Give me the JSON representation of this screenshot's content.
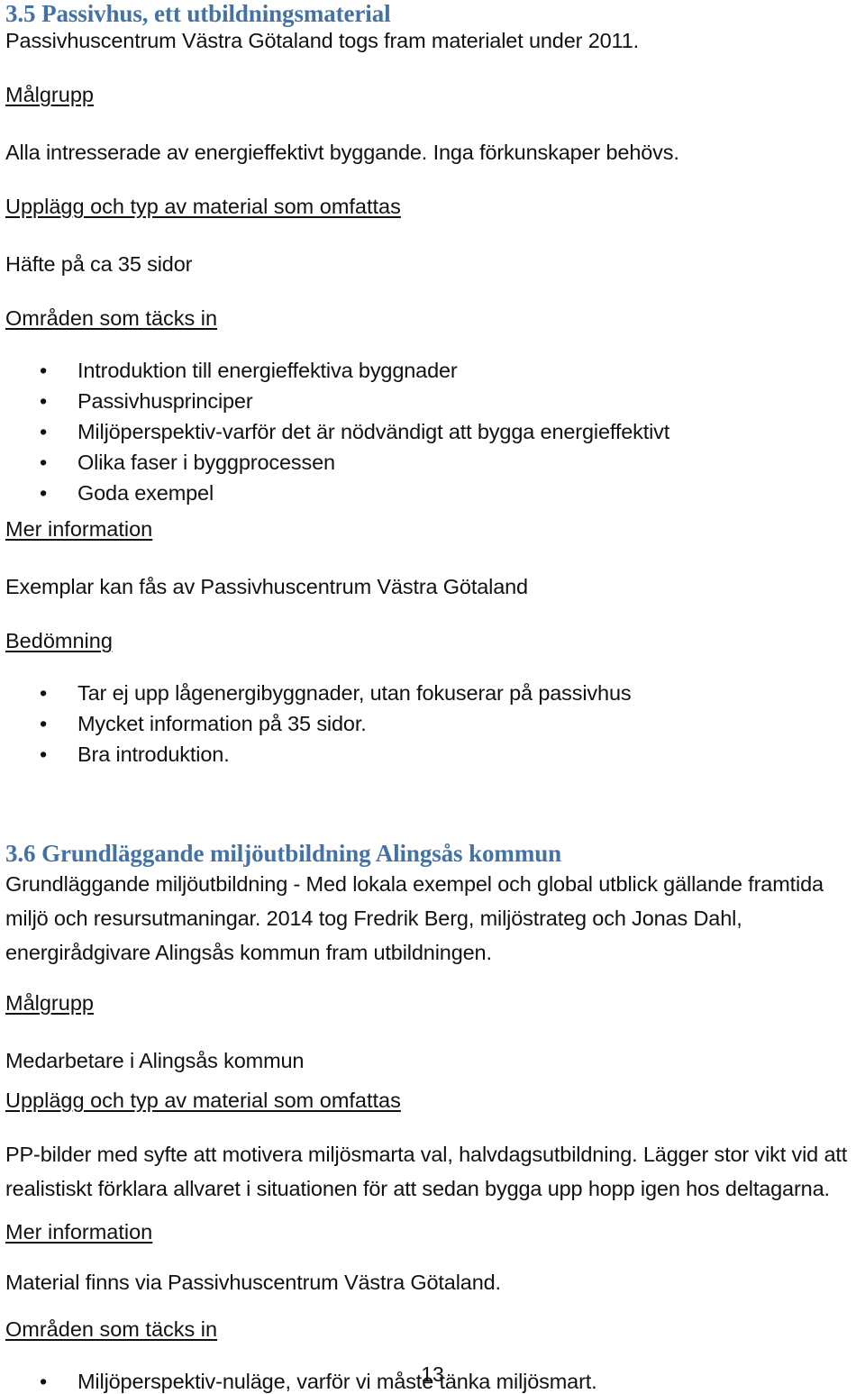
{
  "document": {
    "page_number": "13",
    "heading_color": "#4472a4",
    "text_color": "#111111",
    "background_color": "#ffffff"
  },
  "sections": [
    {
      "id": "3.5",
      "heading": "3.5 Passivhus, ett utbildningsmaterial",
      "intro": "Passivhuscentrum Västra Götaland togs fram materialet under 2011.",
      "blocks": [
        {
          "label": "Målgrupp",
          "text": "Alla intresserade av energieffektivt byggande. Inga förkunskaper behövs."
        },
        {
          "label": "Upplägg och typ av material som omfattas",
          "text": "Häfte på ca 35 sidor"
        },
        {
          "label": "Områden som täcks in",
          "bullets": [
            "Introduktion till energieffektiva byggnader",
            "Passivhusprinciper",
            "Miljöperspektiv-varför det är nödvändigt att bygga energieffektivt",
            "Olika faser i byggprocessen",
            "Goda exempel"
          ]
        },
        {
          "label": "Mer information",
          "text": "Exemplar kan fås av Passivhuscentrum Västra Götaland"
        },
        {
          "label": "Bedömning",
          "bullets": [
            "Tar ej upp lågenergibyggnader, utan fokuserar på passivhus",
            "Mycket information på 35 sidor.",
            "Bra introduktion."
          ]
        }
      ]
    },
    {
      "id": "3.6",
      "heading": "3.6 Grundläggande miljöutbildning Alingsås kommun",
      "intro": "Grundläggande miljöutbildning - Med lokala exempel och global utblick gällande framtida miljö och resursutmaningar. 2014 tog Fredrik Berg, miljöstrateg och Jonas Dahl, energirådgivare Alingsås kommun fram utbildningen.",
      "blocks": [
        {
          "label": "Målgrupp",
          "text": "Medarbetare i Alingsås kommun"
        },
        {
          "label": "Upplägg och typ av material som omfattas",
          "text": "PP-bilder med syfte att motivera miljösmarta val, halvdagsutbildning. Lägger stor vikt vid att realistiskt förklara allvaret i situationen för att sedan bygga upp hopp igen hos deltagarna."
        },
        {
          "label": "Mer information",
          "text": "Material finns via Passivhuscentrum Västra Götaland."
        },
        {
          "label": "Områden som täcks in",
          "bullets": [
            "Miljöperspektiv-nuläge, varför vi måste tänka miljösmart."
          ]
        }
      ]
    }
  ],
  "glyphs": {
    "bullet": "•"
  }
}
